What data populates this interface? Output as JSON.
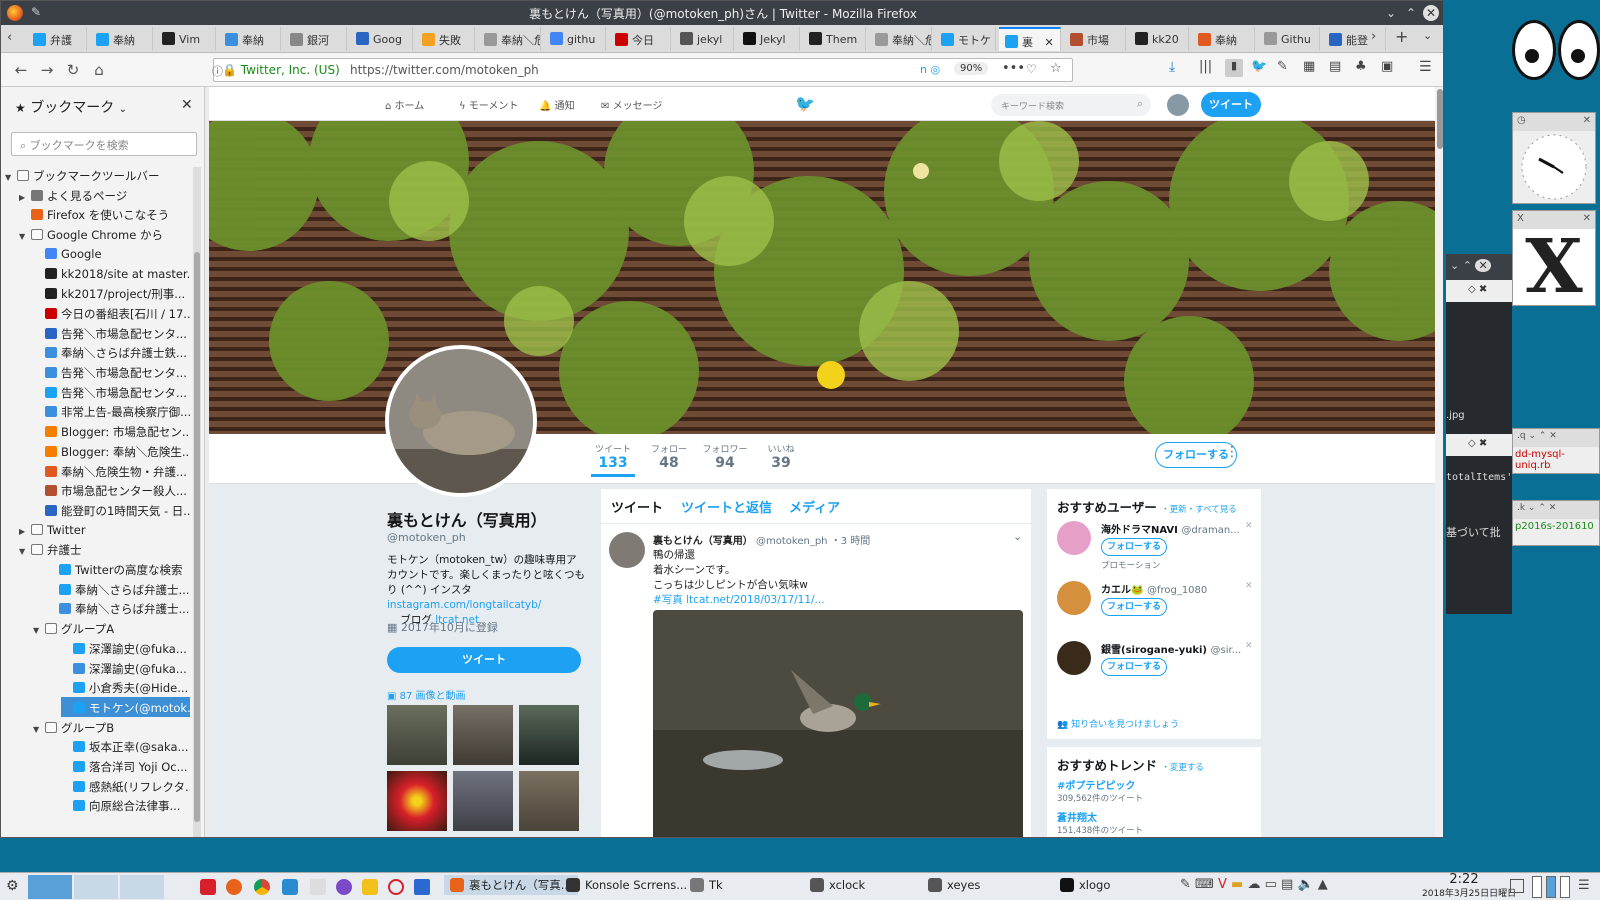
{
  "window": {
    "title": "裏もとけん（写真用）(@motoken_ph)さん | Twitter - Mozilla Firefox"
  },
  "tabs": [
    {
      "label": "弁護",
      "color": "#1da1f2"
    },
    {
      "label": "奉納",
      "color": "#1da1f2"
    },
    {
      "label": "Vim",
      "color": "#222"
    },
    {
      "label": "奉納",
      "color": "#3c8fdc"
    },
    {
      "label": "銀河",
      "color": "#888"
    },
    {
      "label": "Goog",
      "color": "#2966c4"
    },
    {
      "label": "失敗",
      "color": "#f4a020"
    },
    {
      "label": "奉納＼危",
      "color": "#999"
    },
    {
      "label": "githu",
      "color": "#4285f4"
    },
    {
      "label": "今日",
      "color": "#c00"
    },
    {
      "label": "jekyl",
      "color": "#555"
    },
    {
      "label": "Jekyl",
      "color": "#111"
    },
    {
      "label": "Them",
      "color": "#222"
    },
    {
      "label": "奉納＼危",
      "color": "#999"
    },
    {
      "label": "モトケ",
      "color": "#1da1f2"
    },
    {
      "label": "裏",
      "color": "#1da1f2",
      "active": true
    },
    {
      "label": "市場",
      "color": "#b05030"
    },
    {
      "label": "kk20",
      "color": "#222"
    },
    {
      "label": "奉納",
      "color": "#e05a20"
    },
    {
      "label": "Githu",
      "color": "#999"
    },
    {
      "label": "能登",
      "color": "#2966c4"
    }
  ],
  "address": {
    "identity": "Twitter, Inc. (US)",
    "url": "https://twitter.com/motoken_ph",
    "zoom": "90%"
  },
  "sidebar": {
    "title": "ブックマーク",
    "search_placeholder": "ブックマークを検索",
    "items": [
      {
        "label": "ブックマークツールバー",
        "indent": 0,
        "arrow": "▼",
        "folder": true
      },
      {
        "label": "よく見るページ",
        "indent": 1,
        "arrow": "▶",
        "color": "#777"
      },
      {
        "label": "Firefox を使いこなそう",
        "indent": 1,
        "color": "#e8621a"
      },
      {
        "label": "Google Chrome から",
        "indent": 1,
        "arrow": "▼",
        "folder": true
      },
      {
        "label": "Google",
        "indent": 2,
        "color": "#4285f4"
      },
      {
        "label": "kk2018/site at master...",
        "indent": 2,
        "color": "#222"
      },
      {
        "label": "kk2017/project/刑事...",
        "indent": 2,
        "color": "#222"
      },
      {
        "label": "今日の番組表[石川 / 17...",
        "indent": 2,
        "color": "#c00"
      },
      {
        "label": "告発＼市場急配センタ...",
        "indent": 2,
        "color": "#2966c4"
      },
      {
        "label": "奉納＼さらば弁護士鉄...",
        "indent": 2,
        "color": "#3c8fdc"
      },
      {
        "label": "告発＼市場急配センタ...",
        "indent": 2,
        "color": "#3c8fdc"
      },
      {
        "label": "告発＼市場急配センタ...",
        "indent": 2,
        "color": "#1da1f2"
      },
      {
        "label": "非常上告-最高検察庁御...",
        "indent": 2,
        "color": "#3c8fdc"
      },
      {
        "label": "Blogger: 市場急配セン...",
        "indent": 2,
        "color": "#f57d00"
      },
      {
        "label": "Blogger: 奉納＼危険生...",
        "indent": 2,
        "color": "#f57d00"
      },
      {
        "label": "奉納＼危険生物・弁護...",
        "indent": 2,
        "color": "#e05a20"
      },
      {
        "label": "市場急配センター殺人...",
        "indent": 2,
        "color": "#b05030"
      },
      {
        "label": "能登町の1時間天気 - 日...",
        "indent": 2,
        "color": "#2966c4"
      },
      {
        "label": "Twitter",
        "indent": 1,
        "arrow": "▶",
        "folder": true
      },
      {
        "label": "弁護士",
        "indent": 1,
        "arrow": "▼",
        "folder": true
      },
      {
        "label": "Twitterの高度な検索",
        "indent": 3,
        "color": "#1da1f2"
      },
      {
        "label": "奉納＼さらば弁護士...",
        "indent": 3,
        "color": "#1da1f2"
      },
      {
        "label": "奉納＼さらば弁護士...",
        "indent": 3,
        "color": "#3c8fdc"
      },
      {
        "label": "グループA",
        "indent": 2,
        "arrow": "▼",
        "folder": true
      },
      {
        "label": "深澤諭史(@fuka...",
        "indent": 4,
        "color": "#1da1f2"
      },
      {
        "label": "深澤諭史(@fuka...",
        "indent": 4,
        "color": "#3c8fdc"
      },
      {
        "label": "小倉秀夫(@Hide...",
        "indent": 4,
        "color": "#1da1f2"
      },
      {
        "label": "モトケン(@motok...",
        "indent": 4,
        "color": "#1da1f2",
        "selected": true
      },
      {
        "label": "グループB",
        "indent": 2,
        "arrow": "▼",
        "folder": true
      },
      {
        "label": "坂本正幸(@saka...",
        "indent": 4,
        "color": "#1da1f2"
      },
      {
        "label": "落合洋司 Yoji Oc...",
        "indent": 4,
        "color": "#1da1f2"
      },
      {
        "label": "感熱紙(リフレクタ...",
        "indent": 4,
        "color": "#1da1f2"
      },
      {
        "label": "向原総合法律事...",
        "indent": 4,
        "color": "#1da1f2"
      }
    ]
  },
  "twitter": {
    "nav": {
      "home": "ホーム",
      "moments": "モーメント",
      "notifications": "通知",
      "messages": "メッセージ",
      "search_placeholder": "キーワード検索",
      "tweet_button": "ツイート"
    },
    "stats": [
      {
        "label": "ツイート",
        "value": "133",
        "active": true
      },
      {
        "label": "フォロー",
        "value": "48"
      },
      {
        "label": "フォロワー",
        "value": "94"
      },
      {
        "label": "いいね",
        "value": "39"
      }
    ],
    "follow_button": "フォローする",
    "profile": {
      "name": "裏もとけん（写真用）",
      "handle": "@motoken_ph",
      "bio1": "モトケン（motoken_tw）の趣味専用アカウントです。楽しくまったりと呟くつもり (^^) インスタ",
      "bio_link": "instagram.com/longtailcatyb/",
      "bio_blog": "ブログ",
      "blog_link": "ltcat.net",
      "joined": "2017年10月に登録",
      "tweet_button": "ツイート",
      "media": "87 画像と動画"
    },
    "tabs": [
      "ツイート",
      "ツイートと返信",
      "メディア"
    ],
    "tweet": {
      "name": "裏もとけん（写真用）",
      "handle": "@motoken_ph",
      "time": "・3 時間",
      "line1": "鴨の帰還",
      "line2": "着水シーンです。",
      "line3": "こっちは少しピントが合い気味w",
      "link": "#写真 ltcat.net/2018/03/17/11/..."
    },
    "recommend": {
      "title": "おすすめユーザー",
      "refresh": "・更新・すべて見る",
      "users": [
        {
          "name": "海外ドラマNAVI",
          "handle": "@draman...",
          "promo": "プロモーション",
          "color": "#e6a0c8"
        },
        {
          "name": "カエル🐸",
          "handle": "@frog_1080",
          "color": "#d4903c"
        },
        {
          "name": "銀雪(sirogane-yuki)",
          "handle": "@sir...",
          "color": "#3a2a1a"
        }
      ],
      "follow": "フォローする",
      "find": "知り合いを見つけましょう"
    },
    "trends": {
      "title": "おすすめトレンド",
      "change": "・変更する",
      "items": [
        {
          "tag": "#ポプテピピック",
          "count": "309,562件のツイート"
        },
        {
          "tag": "蒼井翔太",
          "count": "151,438件のツイート"
        }
      ]
    }
  },
  "desktop": {
    "fragments": [
      ".jpg",
      "dd-mysql-uniq.rb",
      "totalItems'",
      "基づいて批",
      "p2016s-201610"
    ]
  },
  "taskbar": {
    "items": [
      {
        "label": "裏もとけん（写真...",
        "color": "#e8621a"
      },
      {
        "label": "Konsole Scrrens...",
        "color": "#333"
      },
      {
        "label": "Tk",
        "color": "#777"
      },
      {
        "label": "xclock",
        "color": "#555"
      },
      {
        "label": "xeyes",
        "color": "#555"
      },
      {
        "label": "xlogo",
        "color": "#111"
      }
    ],
    "time": "2:22",
    "date": "2018年3月25日日曜日"
  },
  "colors": {
    "twitter_blue": "#1da1f2",
    "selection": "#3d8fd6",
    "titlebar": "#3b4046"
  }
}
